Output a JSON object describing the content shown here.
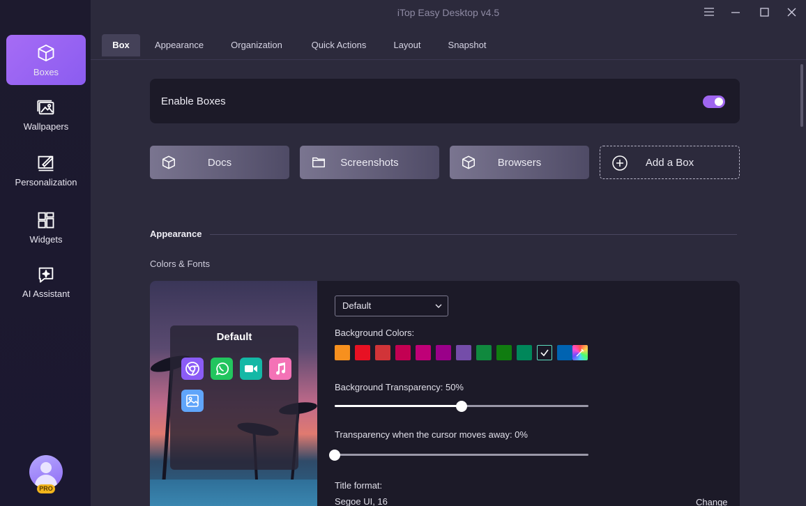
{
  "window": {
    "title": "iTop Easy Desktop v4.5"
  },
  "sidebar": {
    "items": [
      {
        "label": "Boxes",
        "icon": "cube-icon",
        "active": true
      },
      {
        "label": "Wallpapers",
        "icon": "image-icon"
      },
      {
        "label": "Personalization",
        "icon": "edit-icon"
      },
      {
        "label": "Widgets",
        "icon": "widgets-icon"
      },
      {
        "label": "AI Assistant",
        "icon": "ai-chat-icon"
      }
    ],
    "badge": "PRO"
  },
  "tabs": [
    {
      "label": "Box",
      "active": true
    },
    {
      "label": "Appearance"
    },
    {
      "label": "Organization"
    },
    {
      "label": "Quick Actions"
    },
    {
      "label": "Layout"
    },
    {
      "label": "Snapshot"
    }
  ],
  "enable": {
    "label": "Enable Boxes",
    "on": true
  },
  "boxes": [
    {
      "label": "Docs",
      "icon": "cube-icon"
    },
    {
      "label": "Screenshots",
      "icon": "folder-icon"
    },
    {
      "label": "Browsers",
      "icon": "cube-icon"
    }
  ],
  "add_box": {
    "label": "Add a Box"
  },
  "appearance": {
    "heading": "Appearance",
    "subheading": "Colors & Fonts",
    "preview_title": "Default",
    "preset": "Default",
    "bg_colors_label": "Background Colors:",
    "swatches": [
      "#f7901e",
      "#e81123",
      "#d13438",
      "#c30052",
      "#bf0077",
      "#9a0089",
      "#744da9",
      "#10893e",
      "#107c10",
      "#00875a",
      "#1a1826",
      "#0063b1"
    ],
    "transparency_label": "Background Transparency: 50%",
    "transparency_value": 50,
    "cursor_transparency_label": "Transparency when the cursor moves away: 0%",
    "cursor_transparency_value": 0,
    "title_format_label": "Title format:",
    "title_format_value": "Segoe UI, 16",
    "change_label": "Change"
  },
  "colors": {
    "accent": "#9f66f0",
    "background": "#2c2a3c",
    "sidebar": "#1d1a2e"
  }
}
